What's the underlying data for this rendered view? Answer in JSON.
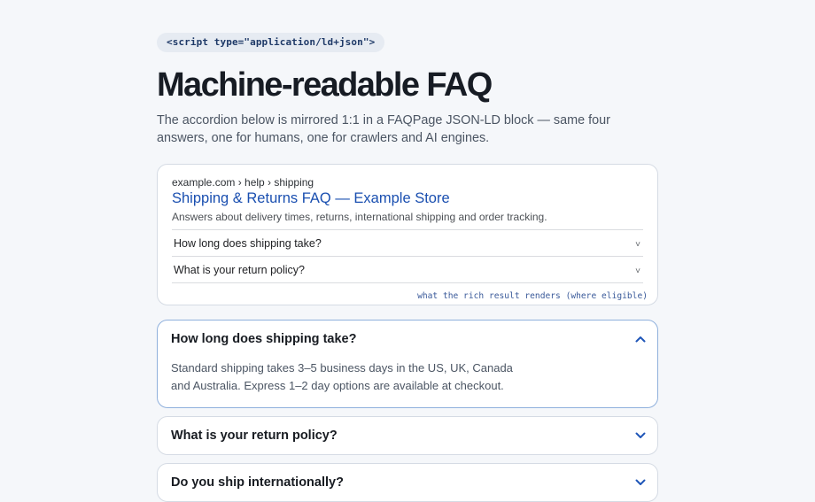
{
  "code_pill": "<script type=\"application/ld+json\">",
  "heading": "Machine-readable FAQ",
  "lead": "The accordion below is mirrored 1:1 in a FAQPage JSON-LD block — same four answers, one for humans, one for crawlers and AI engines.",
  "serp": {
    "breadcrumb": "example.com › help › shipping",
    "title": "Shipping & Returns FAQ — Example Store",
    "description": "Answers about delivery times, returns, international shipping and order tracking.",
    "rows": [
      {
        "question": "How long does shipping take?",
        "chevron": "˅"
      },
      {
        "question": "What is your return policy?",
        "chevron": "˅"
      }
    ],
    "note": "what the rich result renders (where eligible)"
  },
  "faq": [
    {
      "question": "How long does shipping take?",
      "answer": "Standard shipping takes 3–5 business days in the US, UK, Canada and Australia. Express 1–2 day options are available at checkout.",
      "open": true
    },
    {
      "question": "What is your return policy?",
      "open": false
    },
    {
      "question": "Do you ship internationally?",
      "open": false
    }
  ],
  "colors": {
    "accent": "#1a4fb0",
    "open_border": "#8fb0dc",
    "chevron": "#1f56b8"
  }
}
